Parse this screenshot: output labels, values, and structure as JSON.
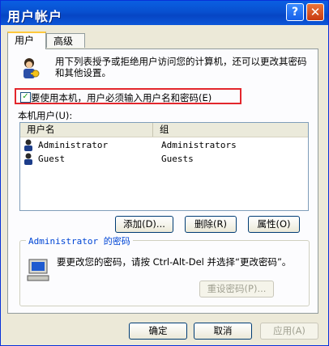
{
  "window": {
    "title": "用户帐户",
    "help_glyph": "?",
    "close_glyph": "✕"
  },
  "tabs": [
    {
      "label": "用户"
    },
    {
      "label": "高级"
    }
  ],
  "intro_text": "用下列表授予或拒绝用户访问您的计算机，还可以更改其密码和其他设置。",
  "checkbox": {
    "checked": true,
    "label": "要使用本机，用户必须输入用户名和密码(E)"
  },
  "users_section": {
    "label": "本机用户(U):",
    "columns": [
      "用户名",
      "组"
    ],
    "rows": [
      {
        "name": "Administrator",
        "group": "Administrators"
      },
      {
        "name": "Guest",
        "group": "Guests"
      }
    ]
  },
  "actions": {
    "add": "添加(D)...",
    "remove": "删除(R)",
    "properties": "属性(O)"
  },
  "password_group": {
    "title": "Administrator 的密码",
    "text": "要更改您的密码，请按 Ctrl-Alt-Del 并选择“更改密码”。",
    "reset_button": "重设密码(P)..."
  },
  "dialog_buttons": {
    "ok": "确定",
    "cancel": "取消",
    "apply": "应用(A)"
  },
  "colors": {
    "title_bar": "#0a5fe2",
    "highlight_border": "#e3262c",
    "group_title": "#0046d5"
  }
}
